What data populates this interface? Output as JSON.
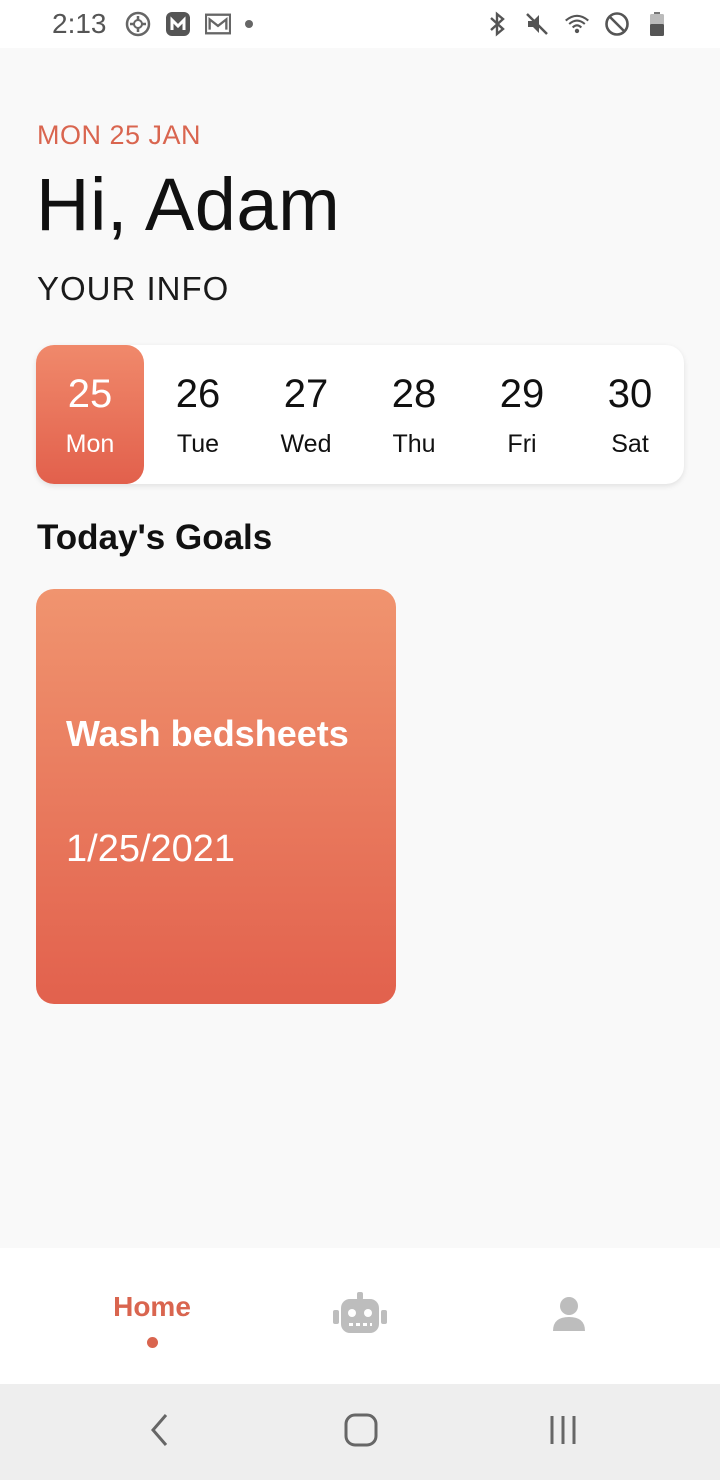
{
  "status_bar": {
    "time": "2:13",
    "left_icons": [
      "location-icon",
      "app-m-icon",
      "gmail-icon",
      "notification-dot-icon"
    ],
    "right_icons": [
      "bluetooth-icon",
      "mute-icon",
      "wifi-icon",
      "dnd-icon",
      "battery-icon"
    ]
  },
  "header": {
    "date_label": "MON 25 JAN",
    "greeting": "Hi, Adam",
    "section_label": "YOUR INFO"
  },
  "calendar": {
    "selected_index": 0,
    "days": [
      {
        "num": "25",
        "name": "Mon"
      },
      {
        "num": "26",
        "name": "Tue"
      },
      {
        "num": "27",
        "name": "Wed"
      },
      {
        "num": "28",
        "name": "Thu"
      },
      {
        "num": "29",
        "name": "Fri"
      },
      {
        "num": "30",
        "name": "Sat"
      }
    ]
  },
  "goals": {
    "title": "Today's Goals",
    "items": [
      {
        "title": "Wash bedsheets",
        "date": "1/25/2021"
      }
    ]
  },
  "bottom_nav": {
    "home_label": "Home",
    "items": [
      "home",
      "robot-icon",
      "user-icon"
    ]
  },
  "colors": {
    "accent": "#d9654f",
    "card_gradient_top": "#f0946f",
    "card_gradient_bottom": "#e2614d",
    "background": "#f9f9f9"
  }
}
